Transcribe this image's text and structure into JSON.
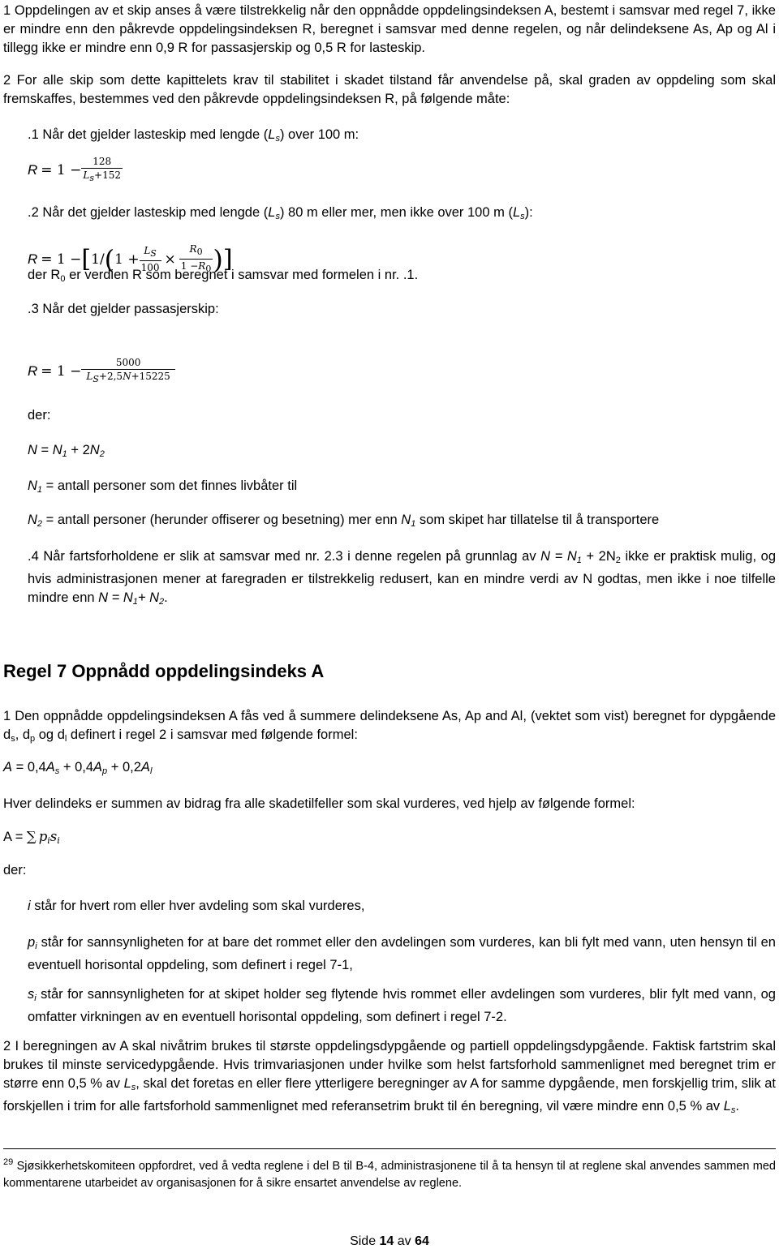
{
  "section_6": {
    "p1": "1 Oppdelingen av et skip anses å være tilstrekkelig når den oppnådde oppdelingsindeksen A, bestemt i samsvar med regel 7, ikke er mindre enn den påkrevde oppdelingsindeksen R, beregnet i samsvar med denne regelen, og når delindeksene As, Ap og Al i tillegg ikke er mindre enn 0,9 R for passasjerskip og 0,5 R for lasteskip.",
    "p2": "2 For alle skip som dette kapittelets krav til stabilitet i skadet tilstand får anvendelse på, skal graden av oppdeling som skal fremskaffes, bestemmes ved den påkrevde oppdelingsindeksen R, på følgende måte:",
    "item1": {
      "pre": ".1 Når det gjelder lasteskip med lengde (",
      "var": "L",
      "sub": "s",
      "post": ") over 100 m:",
      "formula": {
        "lhs": "R",
        "eq": " = 1 − ",
        "num": "128",
        "den_var": "L",
        "den_sub": "s",
        "den_rest": "+152"
      }
    },
    "item2": {
      "pre": ".2 Når det gjelder lasteskip med lengde (",
      "var": "L",
      "sub": "s",
      "mid": ") 80 m eller mer, men ikke over 100 m (",
      "post": "):",
      "formula": {
        "lhs": "R",
        "eq": " = 1 − ",
        "open_bracket": "[",
        "one_slash": "1/",
        "open_paren": "(",
        "one_plus": "1 + ",
        "f1_num_var": "L",
        "f1_num_sub": "S",
        "f1_den": "100",
        "times": "×",
        "f2_num_var": "R",
        "f2_num_sub": "0",
        "f2_den_pre": "1 −",
        "f2_den_var": "R",
        "f2_den_sub": "0",
        "close_paren": ")",
        "close_bracket": "]"
      },
      "note_pre": "der R",
      "note_sub": "0",
      "note_post": " er verdien R som beregnet i samsvar med formelen i nr. .1."
    },
    "item3": {
      "text": ".3 Når det gjelder passasjerskip:",
      "formula": {
        "lhs": "R",
        "eq": " = 1 − ",
        "num": "5000",
        "den_var": "L",
        "den_sub": "S",
        "den_rest": "+2,5",
        "den_n": "N",
        "den_tail": "+15225"
      },
      "der": "der:",
      "n_def": {
        "lhs": "N",
        "eq": " = ",
        "n1": "N",
        "n1_sub": "1",
        "plus": " + 2",
        "n2": "N",
        "n2_sub": "2"
      },
      "n1_def": {
        "var": "N",
        "sub": "1",
        "text": " = antall personer som det finnes livbåter til"
      },
      "n2_def": {
        "var": "N",
        "sub": "2",
        "text": " = antall personer (herunder offiserer og besetning) mer enn ",
        "var2": "N",
        "sub2": "1",
        "text2": " som skipet har tillatelse til å transportere"
      }
    },
    "item4": {
      "pre": ".4 Når fartsforholdene er slik at samsvar med nr. 2.3 i denne regelen på grunnlag av ",
      "f1": "N = N",
      "f1_sub": "1",
      "f1_rest": " + 2N",
      "f1_sub2": "2",
      "mid": " ikke er praktisk mulig, og hvis administrasjonen mener at faregraden er tilstrekkelig redusert, kan en mindre verdi av N godtas, men ikke i noe tilfelle mindre enn ",
      "f2": "N = N",
      "f2_sub": "1",
      "f2_plus": "+ N",
      "f2_sub2": "2",
      "end": "."
    }
  },
  "section_7": {
    "heading": "Regel 7 Oppnådd oppdelingsindeks A",
    "p1_a": "1 Den oppnådde oppdelingsindeksen A fås ved å summere delindeksene As, Ap and Al, (vektet som vist) beregnet for dypgående d",
    "p1_s": "s",
    "p1_b": ", d",
    "p1_p": "p",
    "p1_c": " og d",
    "p1_l": "l",
    "p1_d": " definert i regel 2 i samsvar med følgende formel:",
    "formula_a": {
      "a": "A",
      "eq": " = 0,4",
      "as": "A",
      "as_sub": "s",
      "p1": " + 0,4",
      "ap": "A",
      "ap_sub": "p",
      "p2": " + 0,2",
      "al": "A",
      "al_sub": "l"
    },
    "p2": "Hver delindeks er summen av bidrag fra alle skadetilfeller som skal vurderes, ved hjelp av følgende formel:",
    "formula_sum": {
      "a": "A",
      "eq": " = ",
      "sigma": "∑",
      "p": "p",
      "p_sub": "i",
      "s": "s",
      "s_sub": "i"
    },
    "der": "der:",
    "def_i": {
      "var": "i",
      "text": " står for hvert rom eller hver avdeling som skal vurderes,"
    },
    "def_p": {
      "var": "p",
      "sub": "i",
      "text": " står for sannsynligheten for at bare det rommet eller den avdelingen som vurderes, kan bli fylt med vann, uten hensyn til en eventuell horisontal oppdeling, som definert i regel 7-1,"
    },
    "def_s": {
      "var": "s",
      "sub": "i",
      "text": " står for sannsynligheten for at skipet holder seg flytende hvis rommet eller avdelingen som vurderes, blir fylt med vann, og omfatter virkningen av en eventuell horisontal oppdeling, som definert i regel 7-2."
    },
    "p3_a": "2 I beregningen av A skal nivåtrim brukes til største oppdelingsdypgående og partiell oppdelingsdypgående. Faktisk fartstrim skal brukes til minste servicedypgående. Hvis trimvariasjonen under hvilke som helst fartsforhold sammenlignet med beregnet trim er større enn 0,5 % av ",
    "p3_var": "L",
    "p3_sub": "s",
    "p3_b": ", skal det foretas en eller flere ytterligere beregninger av A for samme dypgående, men forskjellig trim, slik at forskjellen i trim for alle fartsforhold sammenlignet med referansetrim brukt til én beregning, vil være mindre enn 0,5 % av ",
    "p3_var2": "L",
    "p3_sub2": "s",
    "p3_c": "."
  },
  "footnote": {
    "number": "29",
    "text": " Sjøsikkerhetskomiteen oppfordret, ved å vedta reglene i del B til B-4, administrasjonene til å ta hensyn til at reglene skal anvendes sammen med kommentarene utarbeidet av organisasjonen for å sikre ensartet anvendelse av reglene."
  },
  "footer": {
    "side": "Side ",
    "page": "14",
    "av": " av ",
    "total": "64"
  }
}
